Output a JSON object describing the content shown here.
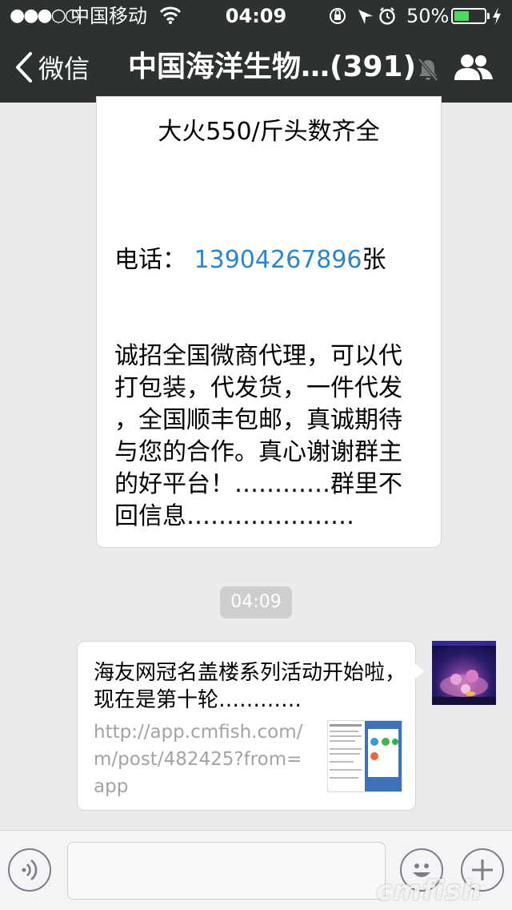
{
  "status_bar": {
    "signal": "●●●○○",
    "carrier": "中国移动",
    "time": "04:09",
    "battery_pct": "50%",
    "battery_level": 0.5,
    "battery_color": "#4cd964"
  },
  "nav": {
    "back_label": "微信",
    "title": "中国海洋生物…(391)",
    "icons": [
      "chevron-left-icon",
      "mute-bell-icon",
      "group-members-icon"
    ]
  },
  "messages": {
    "msg1": {
      "line_head": "大火550/斤头数齐全",
      "phone_label": "电话：",
      "phone_number": "13904267896",
      "phone_suffix": "张",
      "para": [
        "诚招全国微商代理，可以代",
        "打包装，代发货，一件代发",
        "，全国顺丰包邮，真诚期待",
        "与您的合作。真心谢谢群主",
        "的好平台！…………群里不",
        "回信息…………………"
      ]
    },
    "timestamp": "04:09",
    "msg2": {
      "title": "海友网冠名盖楼系列活动开始啦，现在是第十轮…………",
      "url": "http://app.cmfish.com/m/post/482425?from=app"
    }
  },
  "input_bar": {
    "icons": [
      "voice-icon",
      "emoji-icon",
      "plus-icon"
    ]
  },
  "watermark": "cmfish"
}
